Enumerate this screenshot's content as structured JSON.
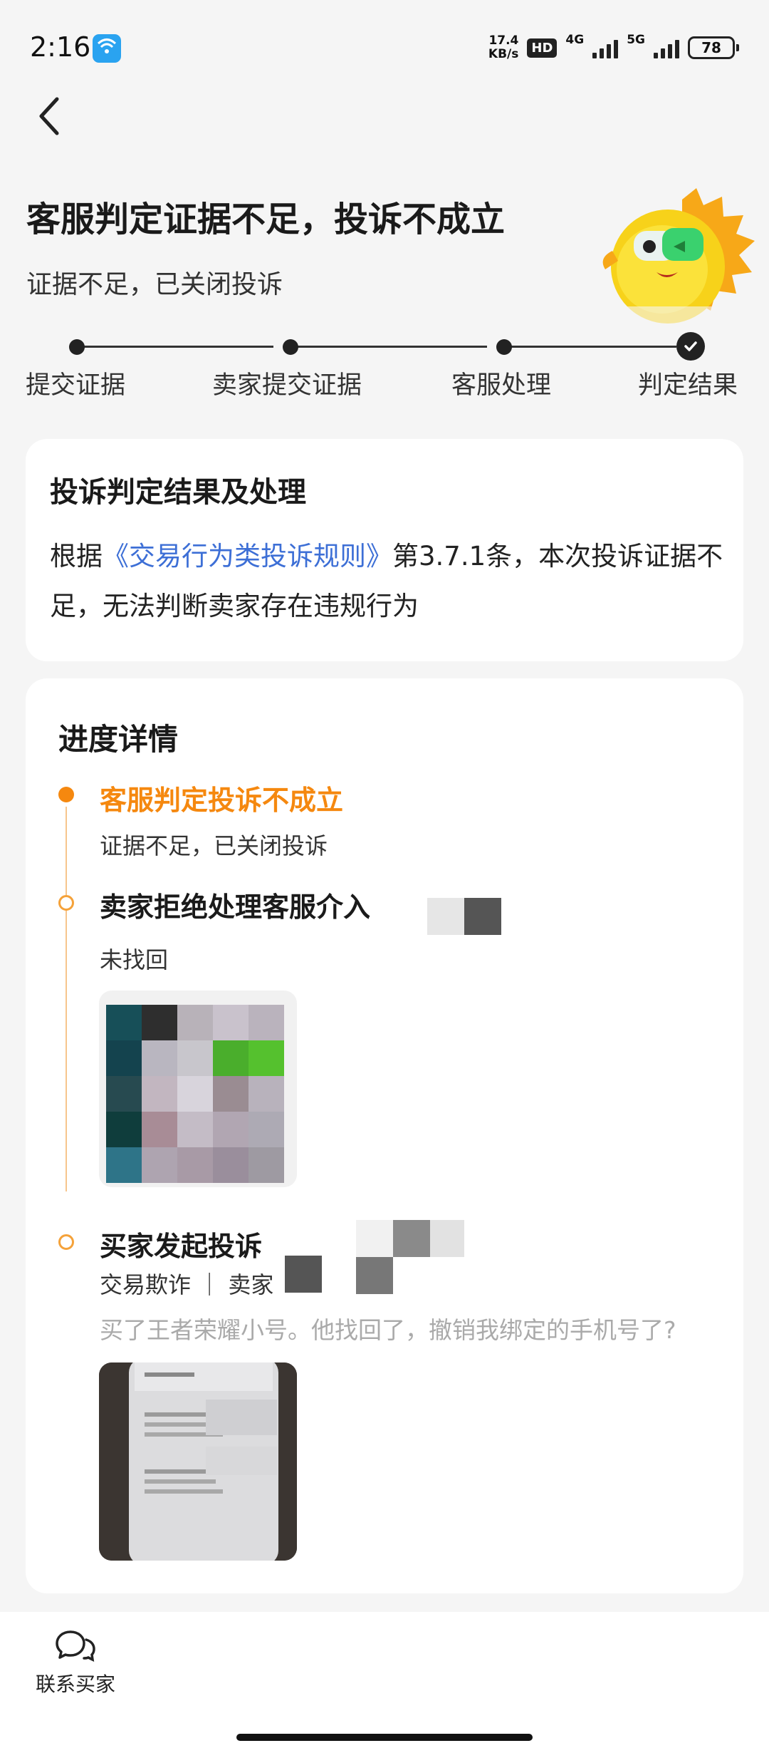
{
  "status_bar": {
    "time": "2:16",
    "net_speed_value": "17.4",
    "net_speed_unit": "KB/s",
    "hd_label": "HD",
    "signal_4g": "4G",
    "signal_5g": "5G",
    "battery": "78"
  },
  "header": {
    "title": "客服判定证据不足，投诉不成立",
    "subtitle": "证据不足，已关闭投诉"
  },
  "steps": [
    {
      "label": "提交证据"
    },
    {
      "label": "卖家提交证据"
    },
    {
      "label": "客服处理"
    },
    {
      "label": "判定结果"
    }
  ],
  "result_card": {
    "title": "投诉判定结果及处理",
    "text_prefix": "根据",
    "rule_link": "《交易行为类投诉规则》",
    "text_suffix": "第3.7.1条，本次投诉证据不足，无法判断卖家存在违规行为"
  },
  "progress": {
    "title": "进度详情",
    "items": [
      {
        "title": "客服判定投诉不成立",
        "sub": "证据不足，已关闭投诉"
      },
      {
        "title": "卖家拒绝处理客服介入",
        "sub": "未找回"
      },
      {
        "title": "买家发起投诉",
        "sub": "交易欺诈 ｜ 卖家",
        "desc": "买了王者荣耀小号。他找回了，撤销我绑定的手机号了?"
      }
    ]
  },
  "bottom_bar": {
    "contact_label": "联系买家"
  },
  "colors": {
    "accent_orange": "#f5880f",
    "link_blue": "#3d6fd6",
    "background": "#f5f5f5"
  }
}
